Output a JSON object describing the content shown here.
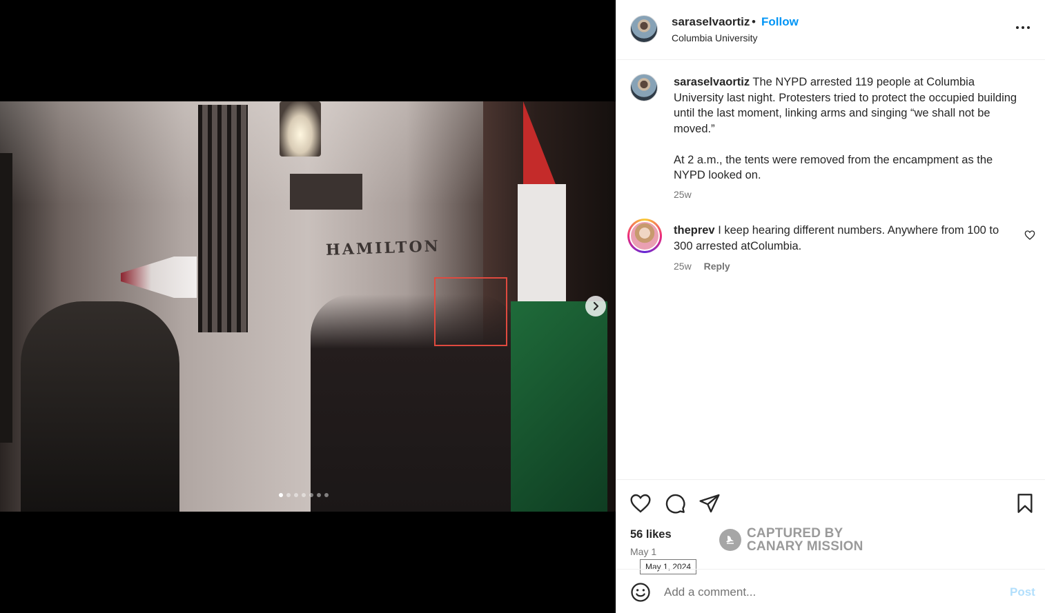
{
  "post": {
    "username": "saraselvaortiz",
    "separator": "•",
    "follow_label": "Follow",
    "location": "Columbia University",
    "more_icon": "more-horizontal-icon"
  },
  "media": {
    "sign_text": "HAMILTON",
    "slide_count": 7,
    "active_slide": 1,
    "next_icon": "chevron-right-icon"
  },
  "caption": {
    "username": "saraselvaortiz",
    "paragraph1": "The NYPD arrested 119 people at Columbia University last night. Protesters tried to protect the occupied building until the last moment, linking arms and singing “we shall not be moved.”",
    "paragraph2": "At 2 a.m., the tents were removed from the encampment as the NYPD looked on.",
    "time": "25w"
  },
  "comments": [
    {
      "username": "theprev",
      "text": "I keep hearing different numbers. Anywhere from 100 to 300 arrested atColumbia.",
      "time": "25w",
      "reply_label": "Reply"
    }
  ],
  "stats": {
    "likes": "56 likes",
    "date": "May 1",
    "date_tooltip": "May 1, 2024"
  },
  "watermark": {
    "line1": "CAPTURED BY",
    "line2": "CANARY MISSION"
  },
  "add_comment": {
    "placeholder": "Add a comment...",
    "post_label": "Post"
  },
  "colors": {
    "accent": "#0095f6",
    "post_disabled": "#b2dffc",
    "highlight_box": "#e04a3f"
  }
}
